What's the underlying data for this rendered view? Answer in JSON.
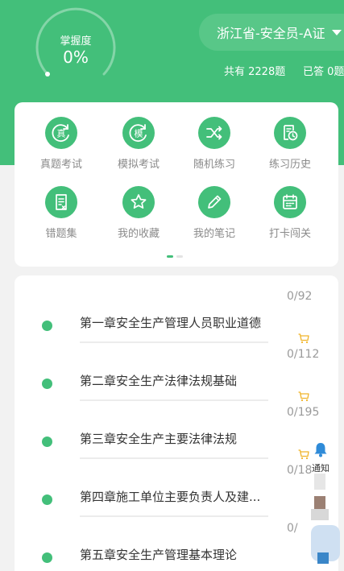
{
  "header": {
    "mastery_label": "掌握度",
    "mastery_value": "0%",
    "mastery_fraction": 0.0,
    "exam_select": "浙江省-安全员-A证",
    "total_text": "共有 2228题",
    "answered_text": "已答 0题"
  },
  "menu": {
    "items": [
      {
        "label": "真题考试",
        "icon": "real-exam-icon"
      },
      {
        "label": "模拟考试",
        "icon": "mock-exam-icon"
      },
      {
        "label": "随机练习",
        "icon": "shuffle-icon"
      },
      {
        "label": "练习历史",
        "icon": "history-icon"
      },
      {
        "label": "错题集",
        "icon": "wrong-questions-icon"
      },
      {
        "label": "我的收藏",
        "icon": "star-icon"
      },
      {
        "label": "我的笔记",
        "icon": "pencil-icon"
      },
      {
        "label": "打卡闯关",
        "icon": "calendar-icon"
      }
    ],
    "real_glyph": "真",
    "mock_glyph": "模"
  },
  "chapters": [
    {
      "title": "第一章安全生产管理人员职业道德",
      "count": "0/92"
    },
    {
      "title": "第二章安全生产法律法规基础",
      "count": "0/112"
    },
    {
      "title": "第三章安全生产主要法律法规",
      "count": "0/195"
    },
    {
      "title": "第四章施工单位主要负责人及建...",
      "count": "0/18"
    },
    {
      "title": "第五章安全生产管理基本理论",
      "count": "0/"
    }
  ],
  "notify": {
    "label": "通知"
  },
  "colors": {
    "brand": "#43bf7a",
    "cart": "#f0b429"
  }
}
